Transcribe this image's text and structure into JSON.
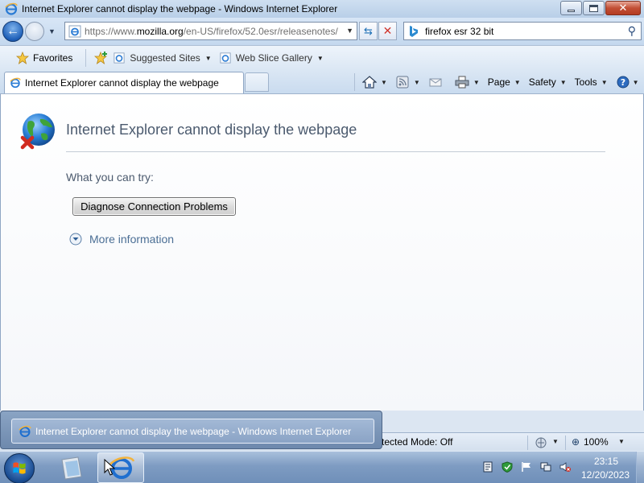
{
  "window": {
    "title": "Internet Explorer cannot display the webpage - Windows Internet Explorer",
    "controls": [
      "minimize-icon",
      "maximize-icon",
      "close-icon"
    ]
  },
  "address": {
    "url_prefix": "https://www.",
    "url_domain": "mozilla.org",
    "url_rest": "/en-US/firefox/52.0esr/releasenotes/"
  },
  "search": {
    "value": "firefox esr 32 bit"
  },
  "favorites_bar": {
    "favorites_label": "Favorites",
    "items": [
      {
        "label": "Suggested Sites",
        "icon": "ie-page-icon"
      },
      {
        "label": "Web Slice Gallery",
        "icon": "ie-page-icon"
      }
    ]
  },
  "tab": {
    "label": "Internet Explorer cannot display the webpage"
  },
  "command_bar": {
    "page_label": "Page",
    "safety_label": "Safety",
    "tools_label": "Tools",
    "icons": [
      "home-icon",
      "feeds-icon",
      "mail-icon",
      "print-icon",
      "help-icon"
    ]
  },
  "content": {
    "heading": "Internet Explorer cannot display the webpage",
    "try_label": "What you can try:",
    "diagnose_button": "Diagnose Connection Problems",
    "more_info": "More information"
  },
  "status": {
    "protected_mode": "tected Mode: Off",
    "zoom": "100%"
  },
  "taskbar_thumbnail": {
    "label": "Internet Explorer cannot display the webpage - Windows Internet Explorer"
  },
  "clock": {
    "time": "23:15",
    "date": "12/20/2023"
  },
  "colors": {
    "accent": "#1e5fb8",
    "close_red": "#c24f35",
    "heading_text": "#4b5a6e",
    "link_text": "#4b6f95"
  }
}
